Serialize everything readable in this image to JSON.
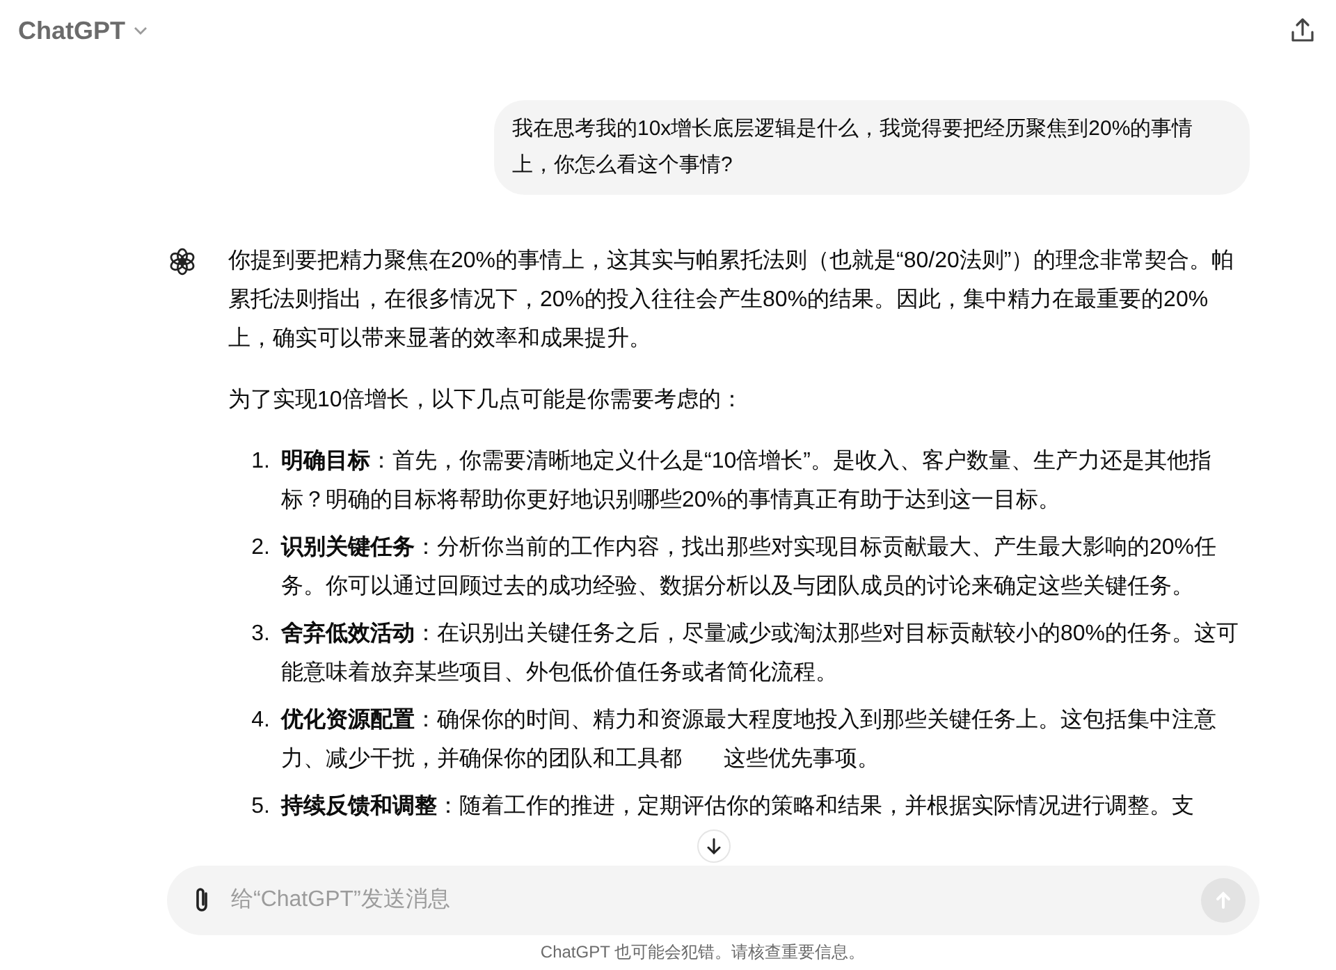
{
  "header": {
    "title": "ChatGPT"
  },
  "user_message": {
    "text": "我在思考我的10x增长底层逻辑是什么，我觉得要把经历聚焦到20%的事情上，你怎么看这个事情?"
  },
  "assistant_message": {
    "paragraphs": [
      "你提到要把精力聚焦在20%的事情上，这其实与帕累托法则（也就是“80/20法则”）的理念非常契合。帕累托法则指出，在很多情况下，20%的投入往往会产生80%的结果。因此，集中精力在最重要的20%上，确实可以带来显著的效率和成果提升。",
      "为了实现10倍增长，以下几点可能是你需要考虑的："
    ],
    "list": [
      {
        "number": "1.",
        "title": "明确目标",
        "text": "：首先，你需要清晰地定义什么是“10倍增长”。是收入、客户数量、生产力还是其他指标？明确的目标将帮助你更好地识别哪些20%的事情真正有助于达到这一目标。"
      },
      {
        "number": "2.",
        "title": "识别关键任务",
        "text": "：分析你当前的工作内容，找出那些对实现目标贡献最大、产生最大影响的20%任务。你可以通过回顾过去的成功经验、数据分析以及与团队成员的讨论来确定这些关键任务。"
      },
      {
        "number": "3.",
        "title": "舍弃低效活动",
        "text": "：在识别出关键任务之后，尽量减少或淘汰那些对目标贡献较小的80%的任务。这可能意味着放弃某些项目、外包低价值任务或者简化流程。"
      },
      {
        "number": "4.",
        "title": "优化资源配置",
        "text": "：确保你的时间、精力和资源最大程度地投入到那些关键任务上。这包括集中注意力、减少干扰，并确保你的团队和工具都",
        "text_after": "这些优先事项。"
      },
      {
        "number": "5.",
        "title": "持续反馈和调整",
        "text": "：随着工作的推进，定期评估你的策略和结果，并根据实际情况进行调整。支"
      }
    ]
  },
  "composer": {
    "placeholder": "给“ChatGPT”发送消息"
  },
  "footer": "ChatGPT 也可能会犯错。请核查重要信息。"
}
